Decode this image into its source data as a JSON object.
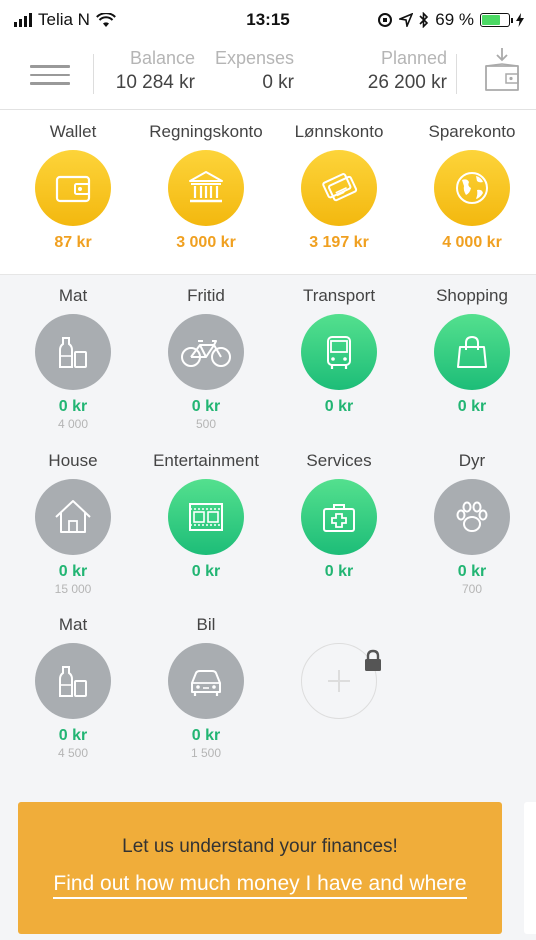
{
  "status": {
    "carrier": "Telia N",
    "time": "13:15",
    "battery": "69 %",
    "battery_level": 0.69
  },
  "header": {
    "balance": {
      "label": "Balance",
      "value": "10 284 kr"
    },
    "expenses": {
      "label": "Expenses",
      "value": "0 kr"
    },
    "planned": {
      "label": "Planned",
      "value": "26 200 kr"
    }
  },
  "accounts": [
    {
      "name": "Wallet",
      "amount": "87 kr",
      "icon": "wallet-icon"
    },
    {
      "name": "Regningskonto",
      "amount": "3 000 kr",
      "icon": "bank-icon"
    },
    {
      "name": "Lønnskonto",
      "amount": "3 197 kr",
      "icon": "cards-icon"
    },
    {
      "name": "Sparekonto",
      "amount": "4 000 kr",
      "icon": "globe-icon"
    }
  ],
  "categories": [
    {
      "name": "Mat",
      "amount": "0 kr",
      "planned": "4 000",
      "icon": "bottles-icon",
      "color": "grey"
    },
    {
      "name": "Fritid",
      "amount": "0 kr",
      "planned": "500",
      "icon": "bicycle-icon",
      "color": "grey"
    },
    {
      "name": "Transport",
      "amount": "0 kr",
      "planned": "",
      "icon": "bus-icon",
      "color": "green"
    },
    {
      "name": "Shopping",
      "amount": "0 kr",
      "planned": "",
      "icon": "shopping-bag-icon",
      "color": "green"
    },
    {
      "name": "House",
      "amount": "0 kr",
      "planned": "15 000",
      "icon": "house-icon",
      "color": "grey"
    },
    {
      "name": "Entertainment",
      "amount": "0 kr",
      "planned": "",
      "icon": "film-icon",
      "color": "green"
    },
    {
      "name": "Services",
      "amount": "0 kr",
      "planned": "",
      "icon": "first-aid-icon",
      "color": "green"
    },
    {
      "name": "Dyr",
      "amount": "0 kr",
      "planned": "700",
      "icon": "paw-icon",
      "color": "grey"
    },
    {
      "name": "Mat",
      "amount": "0 kr",
      "planned": "4 500",
      "icon": "bottles-icon",
      "color": "grey"
    },
    {
      "name": "Bil",
      "amount": "0 kr",
      "planned": "1 500",
      "icon": "car-icon",
      "color": "grey"
    }
  ],
  "banner": {
    "text": "Let us understand your finances!",
    "link": "Find out how much money I have and where"
  }
}
